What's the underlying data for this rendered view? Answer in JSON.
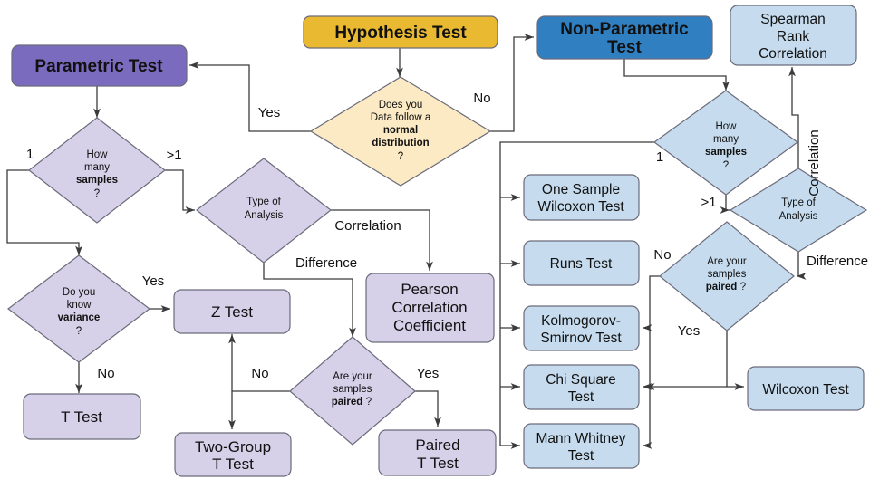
{
  "diagram": {
    "title": "Hypothesis Test selection flowchart",
    "colors": {
      "start_fill": "#e8b931",
      "start_stroke": "#c79a1e",
      "parametric_fill": "#7b6bbe",
      "parametric_stroke": "#6a5aad",
      "nonparametric_fill": "#2f7fc1",
      "nonparametric_stroke": "#2a6ea8",
      "decision_yellow_fill": "#fbeac3",
      "purple_fill": "#d6d0e8",
      "blue_fill": "#c6dcee",
      "node_stroke": "#6b6b7b",
      "edge_stroke": "#3b3b3b"
    },
    "nodes": {
      "start": {
        "label": "Hypothesis Test"
      },
      "normal_decision": {
        "line1": "Does you",
        "line2": "Data follow a",
        "line3": "normal",
        "line4": "distribution",
        "line5": "?"
      },
      "parametric": {
        "label": "Parametric Test"
      },
      "nonparametric": {
        "line1": "Non-Parametric",
        "line2": "Test"
      },
      "p_samples": {
        "line1": "How",
        "line2": "many",
        "line3": "samples",
        "line4": "?"
      },
      "p_variance": {
        "line1": "Do you",
        "line2": "know",
        "line3": "variance",
        "line4": "?"
      },
      "p_ttest": {
        "label": "T Test"
      },
      "p_type": {
        "line1": "Type of",
        "line2": "Analysis"
      },
      "p_ztest": {
        "label": "Z Test"
      },
      "p_paired": {
        "line1": "Are your",
        "line2": "samples",
        "line3": "paired",
        "line4": "?"
      },
      "p_twogroup": {
        "line1": "Two-Group",
        "line2": "T Test"
      },
      "p_pairedt": {
        "line1": "Paired",
        "line2": "T Test"
      },
      "p_pearson": {
        "line1": "Pearson",
        "line2": "Correlation",
        "line3": "Coefficient"
      },
      "np_samples": {
        "line1": "How",
        "line2": "many",
        "line3": "samples",
        "line4": "?"
      },
      "np_type": {
        "line1": "Type of",
        "line2": "Analysis"
      },
      "np_paired": {
        "line1": "Are your",
        "line2": "samples",
        "line3": "paired",
        "line4": "?"
      },
      "np_one_sample_wilcoxon": {
        "line1": "One Sample",
        "line2": "Wilcoxon Test"
      },
      "np_runs": {
        "label": "Runs Test"
      },
      "np_ks": {
        "line1": "Kolmogorov-",
        "line2": "Smirnov Test"
      },
      "np_chisq": {
        "line1": "Chi Square",
        "line2": "Test"
      },
      "np_mannwhitney": {
        "line1": "Mann Whitney",
        "line2": "Test"
      },
      "np_wilcoxon": {
        "label": "Wilcoxon Test"
      },
      "np_spearman": {
        "line1": "Spearman",
        "line2": "Rank",
        "line3": "Correlation"
      }
    },
    "edge_labels": {
      "normal_yes": "Yes",
      "normal_no": "No",
      "p_samples_one": "1",
      "p_samples_many": ">1",
      "p_variance_yes": "Yes",
      "p_variance_no": "No",
      "p_type_correlation": "Correlation",
      "p_type_difference": "Difference",
      "p_paired_no": "No",
      "p_paired_yes": "Yes",
      "np_samples_one": "1",
      "np_samples_many": ">1",
      "np_type_correlation": "Correlation",
      "np_type_difference": "Difference",
      "np_paired_no": "No",
      "np_paired_yes": "Yes"
    }
  }
}
